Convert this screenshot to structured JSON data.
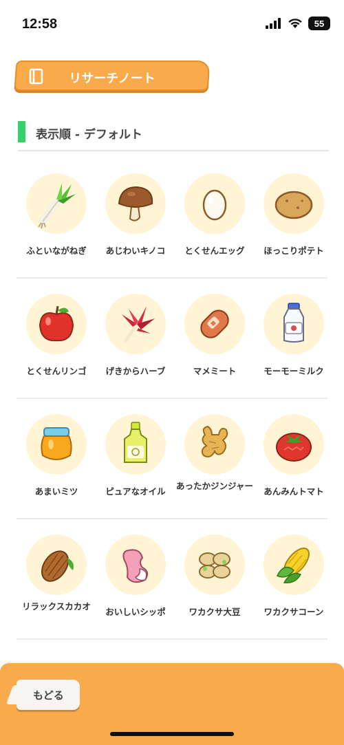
{
  "status": {
    "time": "12:58",
    "battery": "55"
  },
  "header": {
    "title": "リサーチノート"
  },
  "sort": {
    "label": "表示順 - デフォルト"
  },
  "items": [
    {
      "name": "ふといながねぎ",
      "icon": "leek-icon"
    },
    {
      "name": "あじわいキノコ",
      "icon": "mushroom-icon"
    },
    {
      "name": "とくせんエッグ",
      "icon": "egg-icon"
    },
    {
      "name": "ほっこりポテト",
      "icon": "potato-icon"
    },
    {
      "name": "とくせんリンゴ",
      "icon": "apple-icon"
    },
    {
      "name": "げきからハーブ",
      "icon": "herb-icon"
    },
    {
      "name": "マメミート",
      "icon": "sausage-icon"
    },
    {
      "name": "モーモーミルク",
      "icon": "milk-icon"
    },
    {
      "name": "あまいミツ",
      "icon": "honey-icon"
    },
    {
      "name": "ピュアなオイル",
      "icon": "oil-icon"
    },
    {
      "name": "あったかジンジャー",
      "icon": "ginger-icon"
    },
    {
      "name": "あんみんトマト",
      "icon": "tomato-icon"
    },
    {
      "name": "リラックスカカオ",
      "icon": "cacao-icon"
    },
    {
      "name": "おいしいシッポ",
      "icon": "tail-icon"
    },
    {
      "name": "ワカクサ大豆",
      "icon": "soybean-icon"
    },
    {
      "name": "ワカクサコーン",
      "icon": "corn-icon"
    }
  ],
  "footer": {
    "back_label": "もどる"
  },
  "colors": {
    "accent": "#f9ab4c",
    "sort_bar": "#35d06b",
    "circle_bg": "#fff4d3"
  }
}
